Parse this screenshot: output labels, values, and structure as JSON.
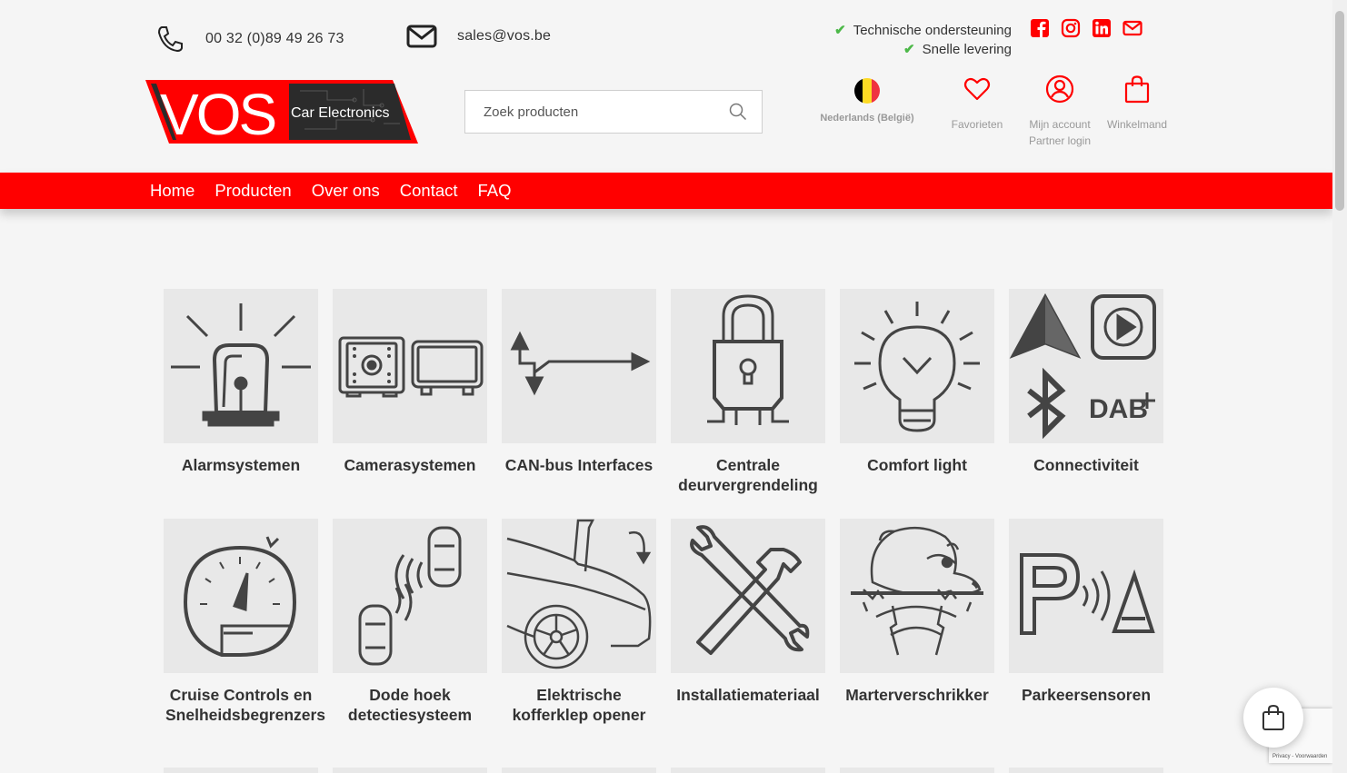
{
  "header": {
    "phone": "00 32 (0)89 49 26 73",
    "email": "sales@vos.be",
    "usps": [
      "Technische ondersteuning",
      "Snelle levering"
    ],
    "social_icons": [
      "facebook-icon",
      "instagram-icon",
      "linkedin-icon",
      "mail-icon"
    ],
    "logo": {
      "brand": "VOS",
      "tagline": "Car Electronics"
    },
    "search": {
      "placeholder": "Zoek producten"
    },
    "language": "Nederlands (België)",
    "favorites": "Favorieten",
    "account": "Mijn account",
    "partner_login": "Partner login",
    "cart": "Winkelmand"
  },
  "nav": {
    "items": [
      "Home",
      "Producten",
      "Over ons",
      "Contact",
      "FAQ"
    ]
  },
  "categories": [
    "Alarmsystemen",
    "Camerasystemen",
    "CAN-bus Interfaces",
    "Centrale deurvergrendeling",
    "Comfort light",
    "Connectiviteit",
    "Cruise Controls en Snelheidsbegrenzers",
    "Dode hoek detectiesysteem",
    "Elektrische kofferklep opener",
    "Installatiemateriaal",
    "Marterverschrikker",
    "Parkeersensoren"
  ],
  "recaptcha": {
    "text": "Privacy - Voorwaarden"
  },
  "colors": {
    "brand_red": "#ff0000",
    "check_green": "#4cb848",
    "icon_dark": "#444444"
  }
}
